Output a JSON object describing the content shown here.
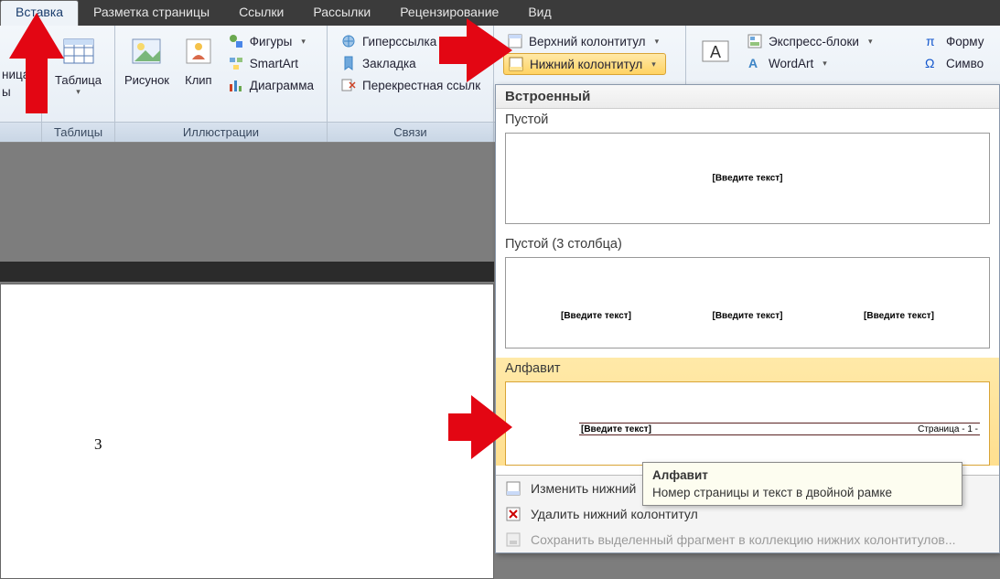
{
  "tabs": {
    "insert": "Вставка",
    "layout": "Разметка страницы",
    "links": "Ссылки",
    "mailings": "Рассылки",
    "review": "Рецензирование",
    "view": "Вид"
  },
  "ribbon": {
    "pages_group": {
      "cover_fragment": "ница",
      "empty_fragment": "ы"
    },
    "tables_group": {
      "label": "Таблицы",
      "table": "Таблица"
    },
    "illustrations_group": {
      "label": "Иллюстрации",
      "picture": "Рисунок",
      "clip": "Клип",
      "shapes": "Фигуры",
      "smartart": "SmartArt",
      "chart": "Диаграмма"
    },
    "links_group": {
      "label": "Связи",
      "hyperlink": "Гиперссылка",
      "bookmark": "Закладка",
      "crossref": "Перекрестная ссылк"
    },
    "headerfooter_group": {
      "header": "Верхний колонтитул",
      "footer": "Нижний колонтитул"
    },
    "text_group": {
      "quickparts": "Экспресс-блоки",
      "wordart": "WordArt"
    },
    "symbols_group": {
      "equation": "Форму",
      "symbol": "Симво"
    }
  },
  "gallery": {
    "title": "Встроенный",
    "item1": {
      "label": "Пустой",
      "placeholder": "[Введите текст]"
    },
    "item2": {
      "label": "Пустой (3 столбца)",
      "placeholder": "[Введите текст]"
    },
    "item3": {
      "label": "Алфавит",
      "placeholder": "[Введите текст]",
      "page": "Страница - 1 -"
    },
    "cmds": {
      "edit": "Изменить нижний",
      "remove": "Удалить нижний колонтитул",
      "save": "Сохранить выделенный фрагмент в коллекцию нижних колонтитулов..."
    }
  },
  "tooltip": {
    "title": "Алфавит",
    "desc": "Номер страницы и текст в двойной рамке"
  },
  "page": {
    "number": "3"
  }
}
